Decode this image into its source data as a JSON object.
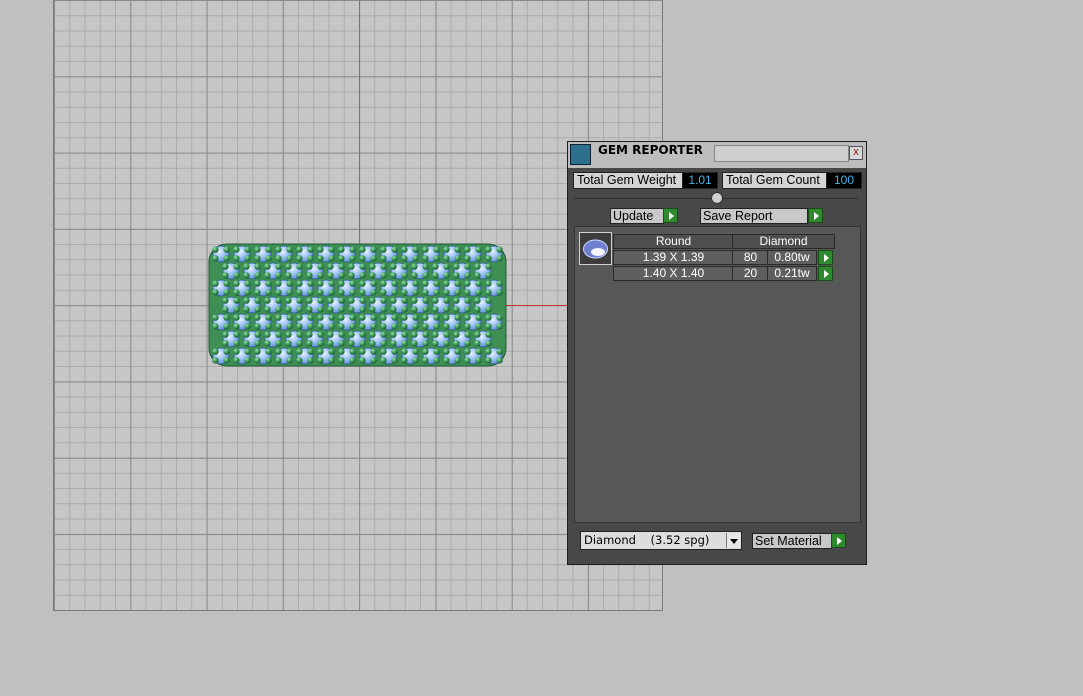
{
  "gem_reporter": {
    "title": "GEM REPORTER",
    "close_glyph": "x",
    "total_weight_label": "Total Gem Weight",
    "total_weight_value": "1.01",
    "total_count_label": "Total Gem Count",
    "total_count_value": "100",
    "update_label": "Update",
    "save_report_label": "Save Report",
    "table": {
      "headers": [
        "Round",
        "Diamond"
      ],
      "rows": [
        {
          "size": "1.39 X 1.39",
          "count": "80",
          "weight": "0.80tw"
        },
        {
          "size": "1.40 X 1.40",
          "count": "20",
          "weight": "0.21tw"
        }
      ]
    },
    "material_selected": "Diamond    (3.52 spg)",
    "set_material_label": "Set Material"
  },
  "colors": {
    "accent_green": "#2f8a2f",
    "value_text": "#3fb7e8",
    "axis_y": "#2a8fb0",
    "axis_x": "#c83232",
    "gem_blue": "#8fb8f0",
    "prong_green": "#3a9a58"
  }
}
